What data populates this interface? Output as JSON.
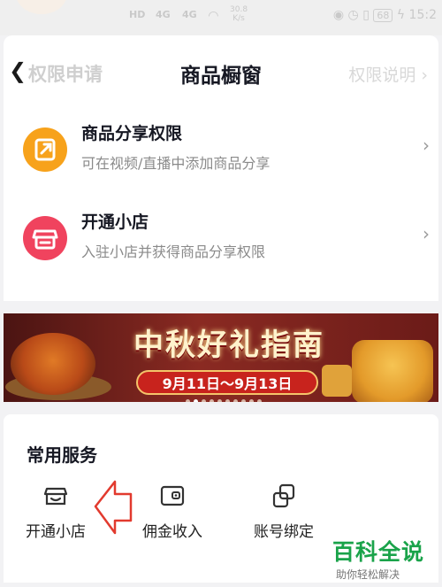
{
  "status_bar": {
    "network_labels": [
      "HD",
      "4G",
      "4G"
    ],
    "speed_value": "30.8",
    "speed_unit": "K/s",
    "battery": "68",
    "time": "15:2"
  },
  "header": {
    "back_label": "权限申请",
    "title": "商品橱窗",
    "right_link": "权限说明"
  },
  "permissions": [
    {
      "title": "商品分享权限",
      "subtitle": "可在视频/直播中添加商品分享",
      "icon": "share-box-icon",
      "color": "#f7a21b"
    },
    {
      "title": "开通小店",
      "subtitle": "入驻小店并获得商品分享权限",
      "icon": "store-icon",
      "color": "#f0435e"
    }
  ],
  "banner": {
    "title": "中秋好礼指南",
    "date_range": "9月11日～9月13日"
  },
  "services": {
    "section_title": "常用服务",
    "items": [
      {
        "label": "开通小店",
        "icon": "store-outline-icon"
      },
      {
        "label": "佣金收入",
        "icon": "wallet-icon"
      },
      {
        "label": "账号绑定",
        "icon": "link-squares-icon"
      }
    ]
  },
  "watermark": {
    "title": "百科全说",
    "subtitle": "助你轻松解决"
  },
  "colors": {
    "accent_orange": "#f7a21b",
    "accent_pink": "#f0435e",
    "annotation_red": "#e23a2e",
    "watermark_green": "#1aa34a"
  }
}
